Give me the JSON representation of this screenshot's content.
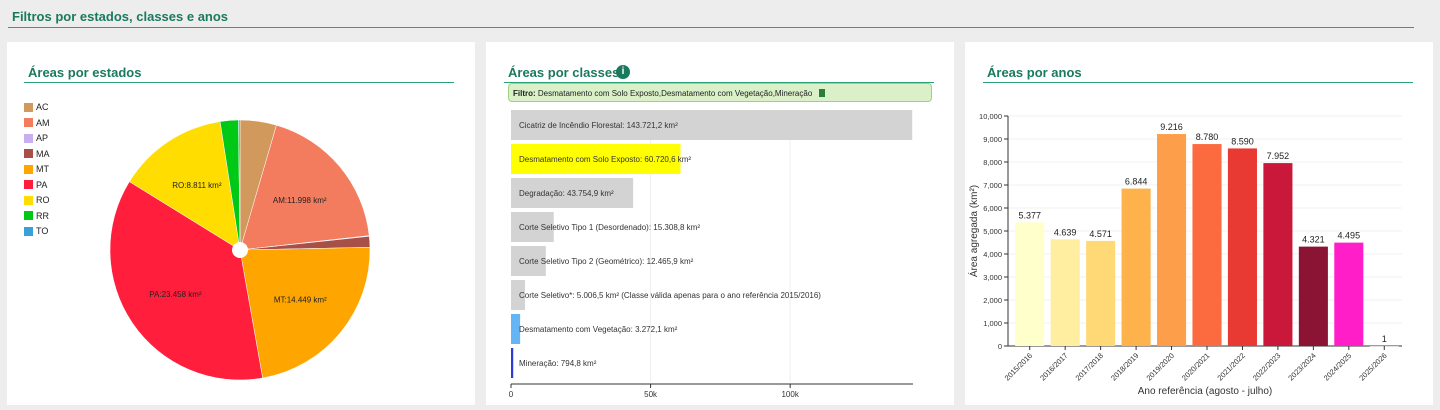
{
  "header": {
    "title": "Filtros por estados, classes e anos"
  },
  "states_panel": {
    "title": "Áreas por estados",
    "legend": [
      {
        "label": "AC",
        "color": "#d19a5c"
      },
      {
        "label": "AM",
        "color": "#f47c5e"
      },
      {
        "label": "AP",
        "color": "#c8b0f0"
      },
      {
        "label": "MA",
        "color": "#a85048"
      },
      {
        "label": "MT",
        "color": "#ffa500"
      },
      {
        "label": "PA",
        "color": "#ff1e3c"
      },
      {
        "label": "RO",
        "color": "#ffdd00"
      },
      {
        "label": "RR",
        "color": "#00c817"
      },
      {
        "label": "TO",
        "color": "#3aa0d8"
      }
    ],
    "slice_labels": {
      "AM": "AM:11.998 km²",
      "MT": "MT:14.449 km²",
      "PA": "PA:23.458 km²",
      "RO": "RO:8.811 km²"
    }
  },
  "classes_panel": {
    "title": "Áreas por classes",
    "filter_label": "Filtro:",
    "filter_value": "Desmatamento com Solo Exposto,Desmatamento com Vegetação,Mineração"
  },
  "years_panel": {
    "title": "Áreas por anos"
  },
  "chart_data": [
    {
      "type": "pie",
      "categories": [
        "AC",
        "AM",
        "AP",
        "MA",
        "MT",
        "PA",
        "RO",
        "RR",
        "TO"
      ],
      "values": [
        2900,
        11998,
        50,
        870,
        14449,
        23458,
        8811,
        1450,
        120
      ]
    },
    {
      "type": "bar",
      "orientation": "horizontal",
      "categories": [
        "Cicatriz de Incêndio Florestal: 143.721,2 km²",
        "Desmatamento com Solo Exposto: 60.720,6 km²",
        "Degradação: 43.754,9 km²",
        "Corte Seletivo Tipo 1 (Desordenado): 15.308,8 km²",
        "Corte Seletivo Tipo 2 (Geométrico): 12.465,9 km²",
        "Corte Seletivo*: 5.006,5 km² (Classe válida apenas para o ano referência 2015/2016)",
        "Desmatamento com Vegetação: 3.272,1 km²",
        "Mineração: 794,8 km²"
      ],
      "values": [
        143721.2,
        60720.6,
        43754.9,
        15308.8,
        12465.9,
        5006.5,
        3272.1,
        794.8
      ],
      "colors": [
        "#d3d3d3",
        "#ffff00",
        "#d3d3d3",
        "#d3d3d3",
        "#d3d3d3",
        "#d3d3d3",
        "#64b5f6",
        "#2a3bd8"
      ],
      "xticks": [
        "0",
        "50k",
        "100k"
      ],
      "xlim": [
        0,
        144000
      ]
    },
    {
      "type": "bar",
      "categories": [
        "2015/2016",
        "2016/2017",
        "2017/2018",
        "2018/2019",
        "2019/2020",
        "2020/2021",
        "2021/2022",
        "2022/2023",
        "2023/2024",
        "2024/2025",
        "2025/2026"
      ],
      "values": [
        5377,
        4639,
        4571,
        6844,
        9216,
        8780,
        8590,
        7952,
        4321,
        4495,
        1
      ],
      "value_labels": [
        "5.377",
        "4.639",
        "4.571",
        "6.844",
        "9.216",
        "8.780",
        "8.590",
        "7.952",
        "4.321",
        "4.495",
        "1"
      ],
      "colors": [
        "#ffffcc",
        "#ffeda0",
        "#fed976",
        "#feb24c",
        "#fd9f4a",
        "#fc6a3f",
        "#e83a32",
        "#c9183a",
        "#8b1434",
        "#ff1ec8",
        "#cccccc"
      ],
      "yticks": [
        "0",
        "1,000",
        "2,000",
        "3,000",
        "4,000",
        "5,000",
        "6,000",
        "7,000",
        "8,000",
        "9,000",
        "10,000"
      ],
      "ylim": [
        0,
        10000
      ],
      "xlabel": "Ano referência (agosto - julho)",
      "ylabel": "Área agregada (km²)"
    }
  ]
}
